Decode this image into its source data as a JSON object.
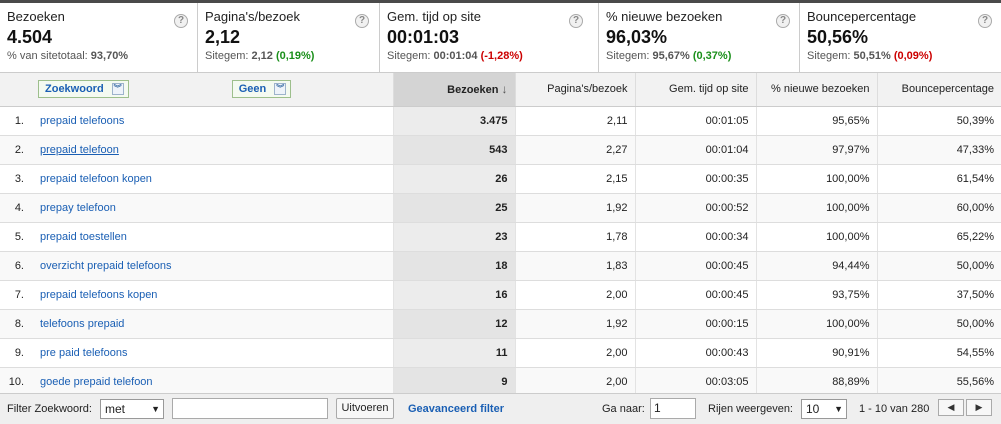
{
  "scorecards": [
    {
      "label": "Bezoeken",
      "value": "4.504",
      "sub_prefix": "% van sitetotaal: ",
      "sub_value": "93,70%",
      "sub_change": ""
    },
    {
      "label": "Pagina's/bezoek",
      "value": "2,12",
      "sub_prefix": "Sitegem: ",
      "sub_value": "2,12",
      "sub_change": "(0,19%)",
      "change_type": "pos"
    },
    {
      "label": "Gem. tijd op site",
      "value": "00:01:03",
      "sub_prefix": "Sitegem: ",
      "sub_value": "00:01:04",
      "sub_change": "(-1,28%)",
      "change_type": "neg"
    },
    {
      "label": "% nieuwe bezoeken",
      "value": "96,03%",
      "sub_prefix": "Sitegem: ",
      "sub_value": "95,67%",
      "sub_change": "(0,37%)",
      "change_type": "pos"
    },
    {
      "label": "Bouncepercentage",
      "value": "50,56%",
      "sub_prefix": "Sitegem: ",
      "sub_value": "50,51%",
      "sub_change": "(0,09%)",
      "change_type": "neg"
    }
  ],
  "help_icon": "?",
  "table": {
    "dimension_dropdown": "Zoekwoord",
    "secondary_dropdown": "Geen",
    "headers": [
      "Bezoeken",
      "Pagina's/bezoek",
      "Gem. tijd op site",
      "% nieuwe bezoeken",
      "Bouncepercentage"
    ],
    "sort_arrow": "↓",
    "rows": [
      {
        "idx": "1.",
        "keyword": "prepaid telefoons",
        "visits": "3.475",
        "ppv": "2,11",
        "time": "00:01:05",
        "new": "95,65%",
        "bounce": "50,39%"
      },
      {
        "idx": "2.",
        "keyword": "prepaid telefoon",
        "visits": "543",
        "ppv": "2,27",
        "time": "00:01:04",
        "new": "97,97%",
        "bounce": "47,33%"
      },
      {
        "idx": "3.",
        "keyword": "prepaid telefoon kopen",
        "visits": "26",
        "ppv": "2,15",
        "time": "00:00:35",
        "new": "100,00%",
        "bounce": "61,54%"
      },
      {
        "idx": "4.",
        "keyword": "prepay telefoon",
        "visits": "25",
        "ppv": "1,92",
        "time": "00:00:52",
        "new": "100,00%",
        "bounce": "60,00%"
      },
      {
        "idx": "5.",
        "keyword": "prepaid toestellen",
        "visits": "23",
        "ppv": "1,78",
        "time": "00:00:34",
        "new": "100,00%",
        "bounce": "65,22%"
      },
      {
        "idx": "6.",
        "keyword": "overzicht prepaid telefoons",
        "visits": "18",
        "ppv": "1,83",
        "time": "00:00:45",
        "new": "94,44%",
        "bounce": "50,00%"
      },
      {
        "idx": "7.",
        "keyword": "prepaid telefoons kopen",
        "visits": "16",
        "ppv": "2,00",
        "time": "00:00:45",
        "new": "93,75%",
        "bounce": "37,50%"
      },
      {
        "idx": "8.",
        "keyword": "telefoons prepaid",
        "visits": "12",
        "ppv": "1,92",
        "time": "00:00:15",
        "new": "100,00%",
        "bounce": "50,00%"
      },
      {
        "idx": "9.",
        "keyword": "pre paid telefoons",
        "visits": "11",
        "ppv": "2,00",
        "time": "00:00:43",
        "new": "90,91%",
        "bounce": "54,55%"
      },
      {
        "idx": "10.",
        "keyword": "goede prepaid telefoon",
        "visits": "9",
        "ppv": "2,00",
        "time": "00:03:05",
        "new": "88,89%",
        "bounce": "55,56%"
      }
    ]
  },
  "footer": {
    "filter_label": "Filter Zoekwoord:",
    "filter_mode": "met",
    "filter_value": "",
    "apply_button": "Uitvoeren",
    "advanced_link": "Geavanceerd filter",
    "goto_label": "Ga naar:",
    "goto_value": "1",
    "rows_label": "Rijen weergeven:",
    "rows_value": "10",
    "range_text": "1 - 10 van 280",
    "prev_icon": "◀",
    "next_icon": "▶"
  }
}
